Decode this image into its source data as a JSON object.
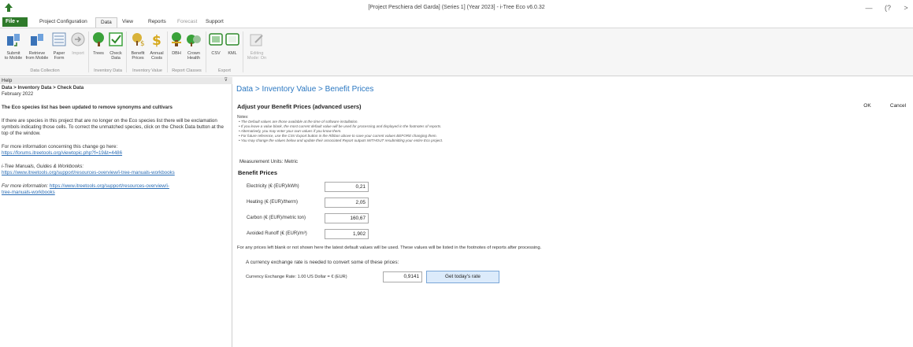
{
  "window": {
    "title": "[Project Peschiera del Garda] (Series 1] (Year 2023] - i-Tree Eco v6.0.32",
    "minimize": "—",
    "help": "(?",
    "more": ">"
  },
  "menu": {
    "file": "File",
    "file_arrow": "▾",
    "tabs": [
      {
        "label": "Project Configuration",
        "state": "normal"
      },
      {
        "label": "Data",
        "state": "active"
      },
      {
        "label": "View",
        "state": "normal"
      },
      {
        "label": "Reports",
        "state": "normal"
      },
      {
        "label": "Forecast",
        "state": "disabled"
      },
      {
        "label": "Support",
        "state": "normal"
      }
    ]
  },
  "ribbon": {
    "buttons": [
      {
        "label1": "Submit",
        "label2": "to Mobile",
        "icon": "upload-icon",
        "state": "normal"
      },
      {
        "label1": "Retrieve",
        "label2": "from Mobile",
        "icon": "download-icon",
        "state": "normal"
      },
      {
        "label1": "Paper",
        "label2": "Form",
        "icon": "paper-form-icon",
        "state": "normal"
      },
      {
        "label1": "Import",
        "label2": "",
        "icon": "import-icon",
        "state": "disabled"
      },
      {
        "label1": "Trees",
        "label2": "",
        "icon": "tree-icon",
        "state": "normal"
      },
      {
        "label1": "Check",
        "label2": "Data",
        "icon": "check-icon",
        "state": "normal"
      },
      {
        "label1": "Benefit",
        "label2": "Prices",
        "icon": "benefit-prices-icon",
        "state": "normal"
      },
      {
        "label1": "Annual",
        "label2": "Costs",
        "icon": "dollar-icon",
        "state": "normal"
      },
      {
        "label1": "DBH",
        "label2": "",
        "icon": "dbh-icon",
        "state": "normal"
      },
      {
        "label1": "Crown",
        "label2": "Health",
        "icon": "crown-health-icon",
        "state": "normal"
      },
      {
        "label1": "CSV",
        "label2": "",
        "icon": "csv-icon",
        "state": "normal"
      },
      {
        "label1": "KML",
        "label2": "",
        "icon": "kml-icon",
        "state": "normal"
      },
      {
        "label1": "Editing",
        "label2": "Mode: On",
        "icon": "editing-icon",
        "state": "disabled"
      }
    ],
    "groups": [
      "Data Collection",
      "Inventory Data",
      "Inventory Value",
      "Report Classes",
      "Export"
    ]
  },
  "help": {
    "header": "Help",
    "pin": "⊽",
    "path": "Data > Inventory Data > Check Data",
    "date": "February 2022",
    "heading": "The Eco species list has been updated to remove synonyms and cultivars",
    "paragraph1": "If there are species in this project that are no longer on the Eco species list there will be exclamation symbols indicating those cells. To correct the unmatched species, click on the Check Data button at the top of the window.",
    "more_info_label": "For more information concerning this change go here:",
    "forum_link": "https://forums.itreetools.org/viewtopic.php?f=19&t=4486",
    "manuals_label": "i-Tree Manuals, Guides & Workbooks:",
    "manuals_link": "https://www.itreetools.org/support/resources-overview/i-tree-manuals-workbooks",
    "more_label": "For more information:",
    "more_link_1": "https://www.itreetools.org/support/resources-overview/i-",
    "more_link_2": "tree-manuals-workbooks"
  },
  "main": {
    "breadcrumb": "Data > Inventory Value > Benefit Prices",
    "ok": "OK",
    "cancel": "Cancel",
    "adjust_title": "Adjust your Benefit Prices (advanced users)",
    "notes_label": "Notes:",
    "notes": [
      "• The Default values are those available at the time of software installation.",
      "• If you leave a value blank, the most current default value will be used for processing and displayed in the footnotes of reports.",
      "• Alternatively, you may enter your own values if you know them.",
      "• For future reference, use the CSV Export button in the Ribbon above to save your current values BEFORE changing them.",
      "• You may change the values below and update their associated Report outputs WITHOUT resubmitting your entire Eco project."
    ],
    "units": "Measurement Units: Metric",
    "benefit_title": "Benefit Prices",
    "prices": [
      {
        "label": "Electricity (€ (EUR)/kWh)",
        "value": "0,21"
      },
      {
        "label": "Heating (€ (EUR)/therm)",
        "value": "2,05"
      },
      {
        "label": "Carbon (€ (EUR)/metric ton)",
        "value": "160,67"
      },
      {
        "label": "Avoided Runoff (€ (EUR)/m³)",
        "value": "1,902"
      }
    ],
    "footnote": "For any prices left blank or not shown here the latest default values will be used. These values will be listed in the footnotes of reports after processing.",
    "currency_note": "A currency exchange rate is needed to convert some of these prices:",
    "rate_label": "Currency Exchange Rate: 1.00 US Dollar = € (EUR)",
    "rate_value": "0,9141",
    "rate_button": "Get today's rate"
  }
}
